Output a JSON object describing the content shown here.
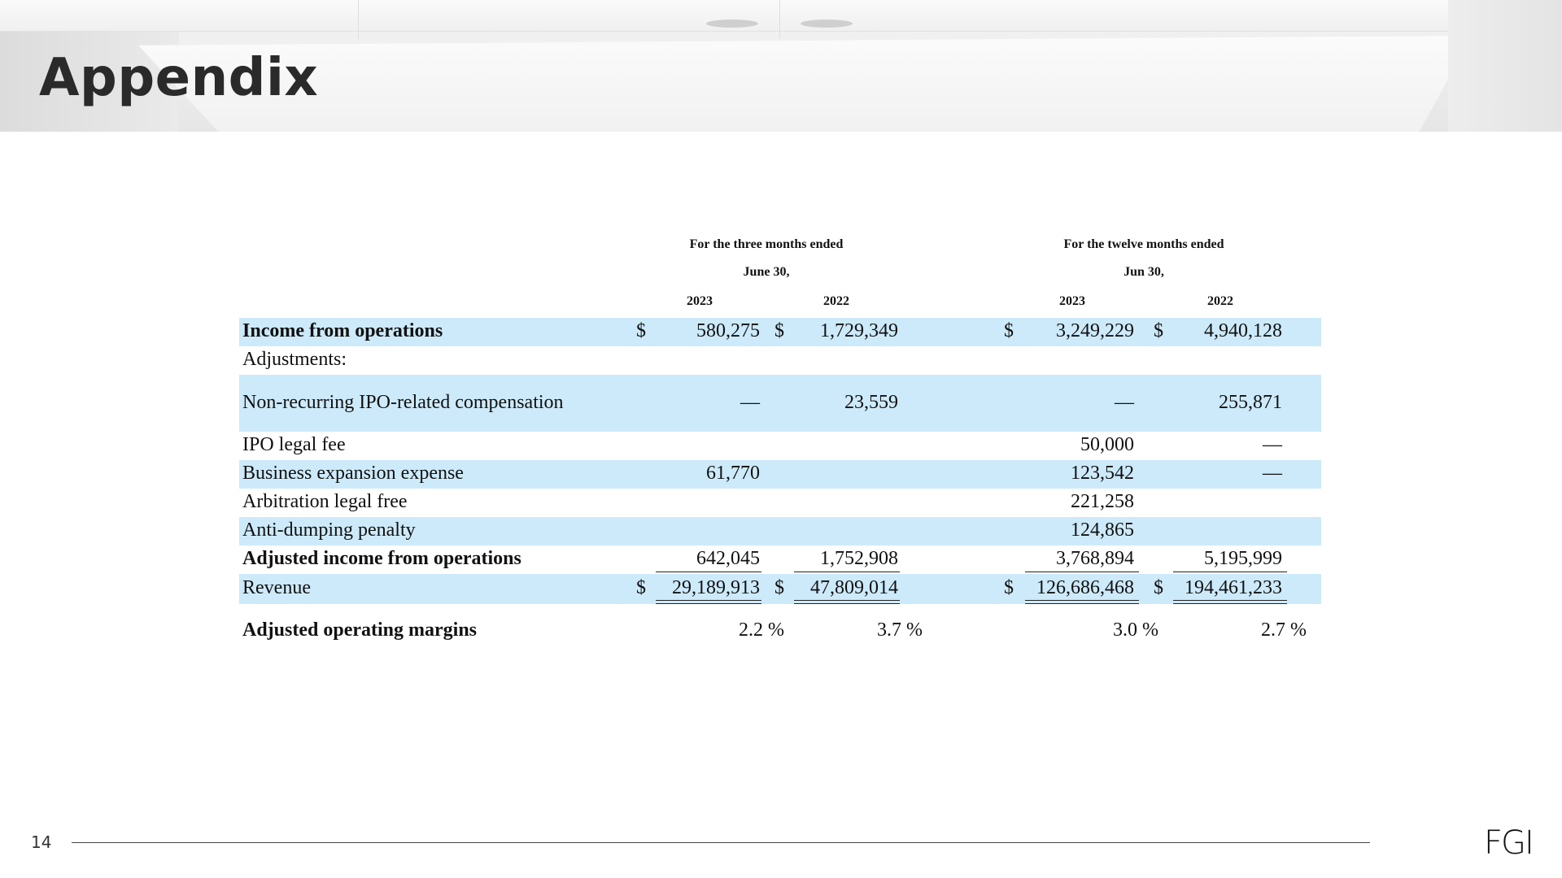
{
  "slide": {
    "title": "Appendix",
    "page_number": "14",
    "logo_text": "FGI"
  },
  "table": {
    "header": {
      "three_months_line1": "For the three months ended",
      "three_months_line2": "June 30,",
      "twelve_months_line1": "For the twelve months ended",
      "twelve_months_line2": "Jun 30,",
      "years": [
        "2023",
        "2022",
        "2023",
        "2022"
      ]
    },
    "currency_symbol": "$",
    "rows": [
      {
        "label": "Income from operations",
        "values": [
          "580,275",
          "1,729,349",
          "3,249,229",
          "4,940,128"
        ]
      },
      {
        "label": "Adjustments:",
        "values": [
          "",
          "",
          "",
          ""
        ]
      },
      {
        "label": "Non-recurring IPO-related compensation",
        "values": [
          "—",
          "23,559",
          "—",
          "255,871"
        ]
      },
      {
        "label": "IPO legal fee",
        "values": [
          "",
          "",
          "50,000",
          "—"
        ]
      },
      {
        "label": "Business expansion expense",
        "values": [
          "61,770",
          "",
          "123,542",
          "—"
        ]
      },
      {
        "label": "Arbitration legal free",
        "values": [
          "",
          "",
          "221,258",
          ""
        ]
      },
      {
        "label": "Anti-dumping penalty",
        "values": [
          "",
          "",
          "124,865",
          ""
        ]
      },
      {
        "label": "Adjusted income from operations",
        "values": [
          "642,045",
          "1,752,908",
          "3,768,894",
          "5,195,999"
        ]
      },
      {
        "label": "Revenue",
        "values": [
          "29,189,913",
          "47,809,014",
          "126,686,468",
          "194,461,233"
        ]
      },
      {
        "label": "Adjusted operating margins",
        "values": [
          "2.2 %",
          "3.7 %",
          "3.0 %",
          "2.7 %"
        ]
      }
    ]
  }
}
